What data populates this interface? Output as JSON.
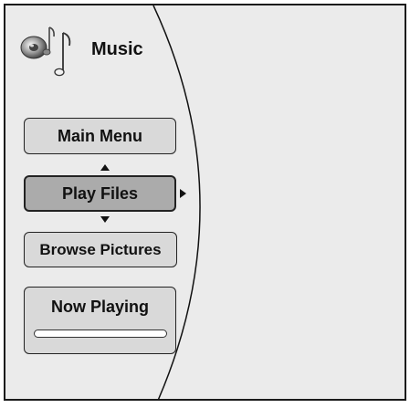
{
  "header": {
    "title": "Music",
    "icon": "music-note-speaker-icon"
  },
  "menu": {
    "items": [
      {
        "label": "Main Menu",
        "selected": false
      },
      {
        "label": "Play Files",
        "selected": true
      },
      {
        "label": "Browse Pictures",
        "selected": false
      }
    ]
  },
  "now_playing": {
    "label": "Now Playing",
    "progress": 0
  },
  "colors": {
    "background": "#ebebeb",
    "button": "#d9d9d9",
    "button_selected": "#ababab",
    "border": "#222222"
  }
}
